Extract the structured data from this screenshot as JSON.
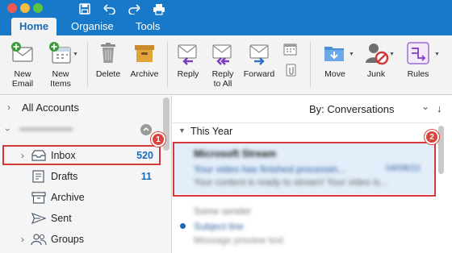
{
  "ribbon": {
    "tabs": [
      {
        "label": "Home",
        "active": true
      },
      {
        "label": "Organise",
        "active": false
      },
      {
        "label": "Tools",
        "active": false
      }
    ],
    "buttons": {
      "new_email": "New\nEmail",
      "new_items": "New\nItems",
      "delete": "Delete",
      "archive": "Archive",
      "reply": "Reply",
      "reply_all": "Reply\nto All",
      "forward": "Forward",
      "move": "Move",
      "junk": "Junk",
      "rules": "Rules"
    }
  },
  "sidebar": {
    "all_accounts": "All Accounts",
    "account_name": "•••••••••••••••••••••••",
    "folders": [
      {
        "label": "Inbox",
        "count": "520",
        "icon": "inbox-icon"
      },
      {
        "label": "Drafts",
        "count": "11",
        "icon": "drafts-icon"
      },
      {
        "label": "Archive",
        "count": "",
        "icon": "archive-icon"
      },
      {
        "label": "Sent",
        "count": "",
        "icon": "sent-icon"
      },
      {
        "label": "Groups",
        "count": "",
        "icon": "groups-icon"
      }
    ],
    "callout": "1"
  },
  "message_list": {
    "sort_label": "By: Conversations",
    "group_header": "This Year",
    "callout": "2",
    "selected_message": {
      "sender": "Microsoft Stream",
      "subject": "Your video has finished processin...",
      "date": "04/08/22",
      "preview": "Your content is ready to stream! Your video is..."
    },
    "next_message": {
      "sender": "Some sender",
      "subject": "Subject line",
      "preview": "Message preview text"
    }
  },
  "colors": {
    "ribbon_blue": "#1779c8",
    "accent_blue": "#1a6bb5",
    "highlight_red": "#d23a3a",
    "selection_bg": "#e3eefa"
  }
}
